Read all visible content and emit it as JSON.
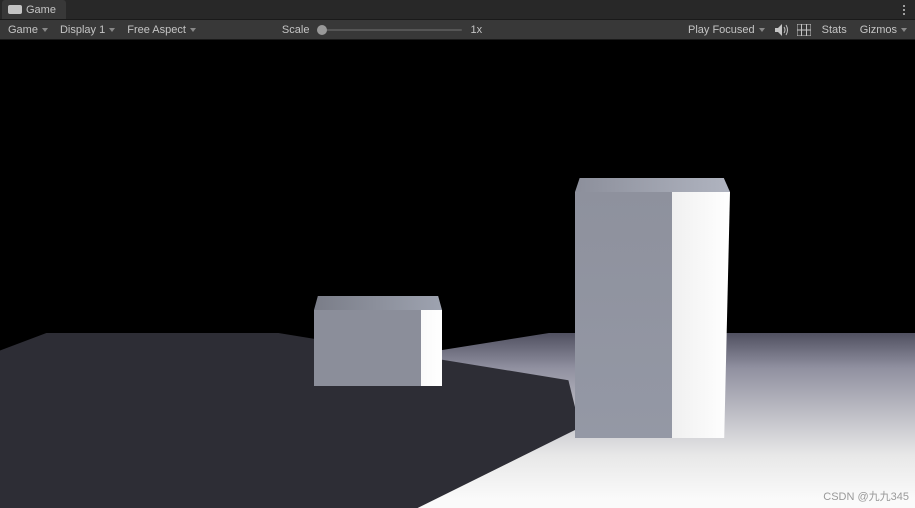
{
  "tab": {
    "label": "Game"
  },
  "toolbar": {
    "view_mode": "Game",
    "display": "Display 1",
    "aspect": "Free Aspect",
    "scale_label": "Scale",
    "scale_value": "1x",
    "play_mode": "Play Focused",
    "stats_label": "Stats",
    "gizmos_label": "Gizmos"
  },
  "watermark": "CSDN @九九345"
}
